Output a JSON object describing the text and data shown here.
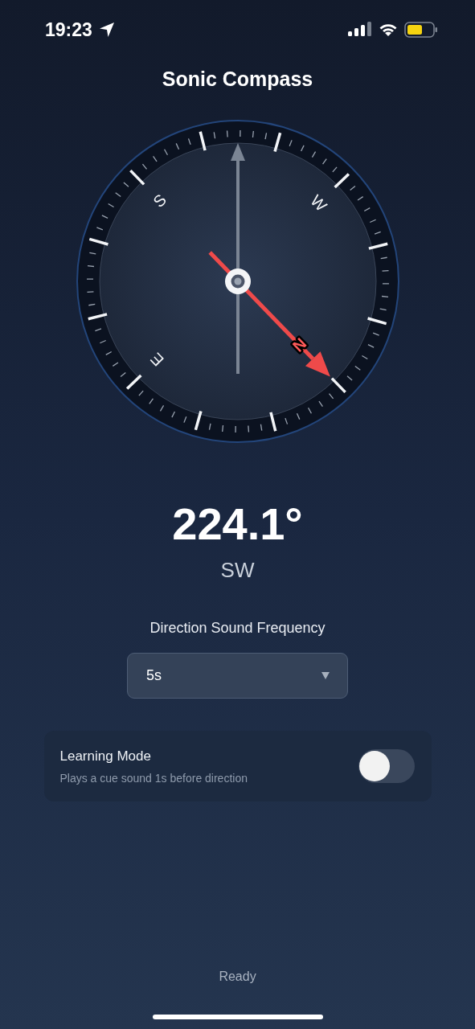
{
  "status_bar": {
    "time": "19:23"
  },
  "title": "Sonic Compass",
  "compass": {
    "cardinals": [
      {
        "label": "N",
        "kind": "north"
      },
      {
        "label": "E",
        "kind": "plain"
      },
      {
        "label": "S",
        "kind": "plain"
      },
      {
        "label": "W",
        "kind": "plain"
      }
    ]
  },
  "heading": "224.1°",
  "direction": "SW",
  "frequency": {
    "label": "Direction Sound Frequency",
    "value": "5s"
  },
  "learning_mode": {
    "title": "Learning Mode",
    "description": "Plays a cue sound 1s before direction",
    "on": false
  },
  "status": "Ready"
}
